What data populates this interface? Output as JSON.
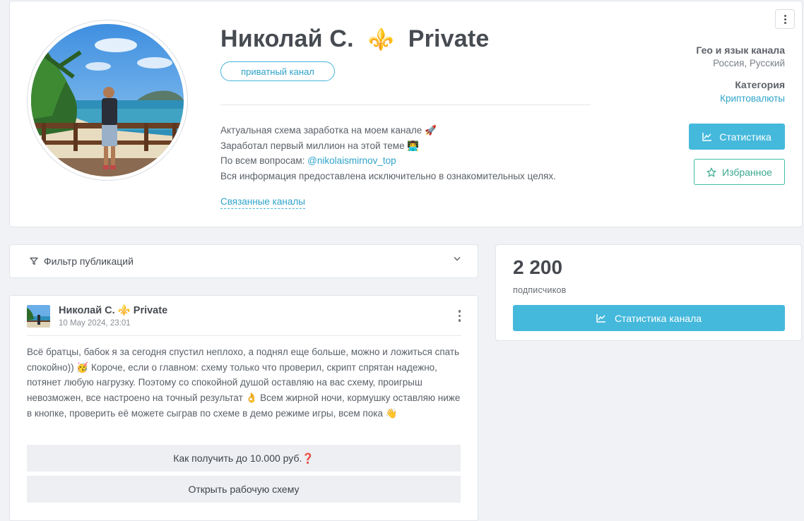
{
  "channel": {
    "name": "Николай С.",
    "name_emoji": "⚜️",
    "name_suffix": "Private",
    "badge": "приватный канал",
    "description_lines": [
      "Актуальная схема заработка на моем канале 🚀",
      "Заработал первый миллион на этой теме 👨‍💻"
    ],
    "contact_prefix": "По всем вопросам: ",
    "contact_handle": "@nikolaismirnov_top",
    "disclaimer": "Вся информация предоставлена исключительно в ознакомительных целях.",
    "related_link": "Связанные каналы",
    "geo_label": "Гео и язык канала",
    "geo_value": "Россия, Русский",
    "category_label": "Категория",
    "category_value": "Криптовалюты",
    "stats_button": "Статистика",
    "favorite_button": "Избранное"
  },
  "filter": {
    "label": "Фильтр публикаций"
  },
  "stats": {
    "subscribers": "2 200",
    "subscribers_label": "подписчиков",
    "button": "Статистика канала"
  },
  "post": {
    "author": "Николай С. ⚜️ Private",
    "date": "10 May 2024, 23:01",
    "text": "Всё братцы, бабок я за сегодня спустил неплохо, а поднял еще больше, можно и ложиться спать спокойно)) 🥳 Короче, если о главном: схему только что проверил, скрипт спрятан надежно, потянет любую нагрузку. Поэтому со спокойной душой оставляю на вас схему, проигрыш невозможен, все настроено на точный результат 👌 Всем жирной ночи, кормушку оставляю ниже в кнопке, проверить её можете сыграв по схеме в демо режиме игры, всем пока 👋",
    "buttons": [
      "Как получить до 10.000 руб.❓",
      "Открыть рабочую схему"
    ]
  },
  "icons": {
    "more": "more-vertical-icon",
    "chart": "line-chart-icon",
    "star": "star-icon",
    "filter": "filter-icon",
    "chevron": "chevron-down-icon"
  },
  "colors": {
    "accent": "#45b9dc",
    "favorite": "#3fbea0",
    "link": "#2fa3c9"
  }
}
